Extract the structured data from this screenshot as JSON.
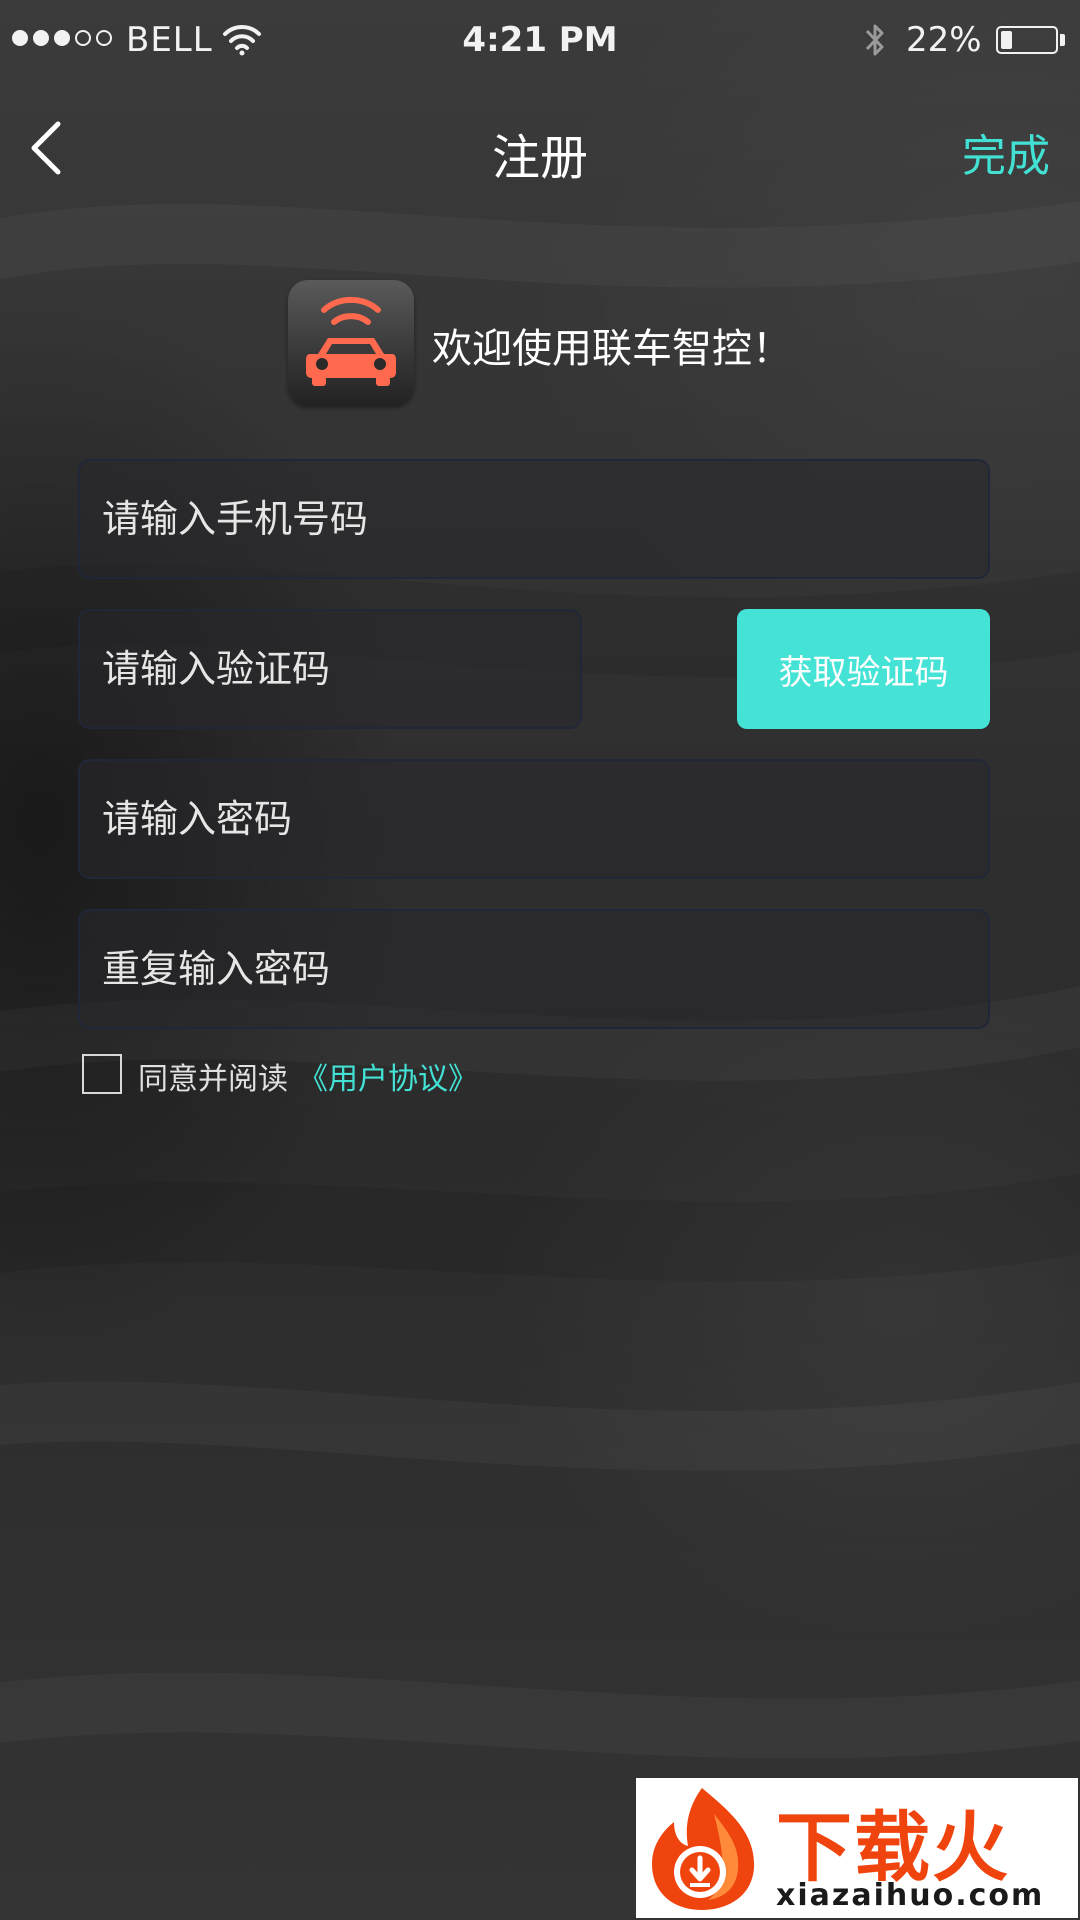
{
  "status_bar": {
    "carrier": "BELL",
    "time": "4:21 PM",
    "battery_percent": "22%",
    "battery_level": 0.22,
    "signal_strength": 3,
    "signal_max": 5,
    "icons": [
      "signal-dots-icon",
      "wifi-icon",
      "bluetooth-icon",
      "battery-icon"
    ]
  },
  "nav": {
    "back_icon": "chevron-left-icon",
    "title": "注册",
    "done_label": "完成"
  },
  "welcome": {
    "logo_icon": "connected-car-icon",
    "text": "欢迎使用联车智控！"
  },
  "form": {
    "phone_placeholder": "请输入手机号码",
    "code_placeholder": "请输入验证码",
    "get_code_label": "获取验证码",
    "password_placeholder": "请输入密码",
    "repeat_password_placeholder": "重复输入密码"
  },
  "agreement": {
    "checked": false,
    "text": "同意并阅读",
    "link": "《用户协议》"
  },
  "watermark": {
    "title": "下载火",
    "url": "xiazaihuo.com"
  },
  "colors": {
    "accent": "#43e0d4",
    "button_bg": "#45e2d6",
    "logo_car": "#ff6a4f",
    "watermark_red": "#f0440e",
    "background": "#333333"
  }
}
